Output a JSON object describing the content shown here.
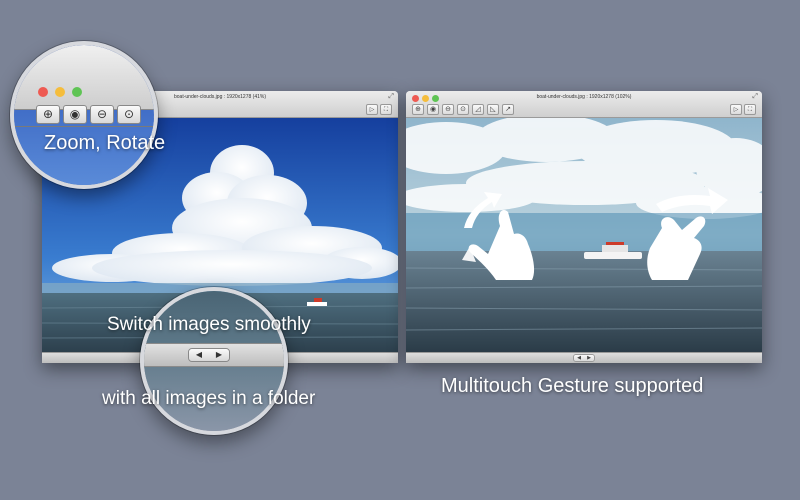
{
  "window": {
    "title": "boat-under-clouds.jpg : 1920x1278 (41%)",
    "title_right": "boat-under-clouds.jpg : 1920x1278 (102%)"
  },
  "icons": {
    "zoom_in": "zoom-in-icon",
    "zoom_actual": "zoom-actual-size-icon",
    "zoom_out": "zoom-out-icon",
    "zoom_fit": "zoom-fit-icon",
    "rotate_left": "rotate-left-icon",
    "rotate_right": "rotate-right-icon",
    "share": "share-icon",
    "slideshow": "slideshow-icon",
    "fullscreen": "fullscreen-icon",
    "prev": "prev-arrow-icon",
    "next": "next-arrow-icon",
    "pinch_gesture": "pinch-gesture-icon",
    "swipe_gesture": "swipe-gesture-icon"
  },
  "captions": {
    "zoom_rotate": "Zoom, Rotate",
    "switch_images": "Switch images smoothly",
    "folder": "with all images in a folder",
    "multitouch": "Multitouch Gesture supported"
  },
  "colors": {
    "background": "#7b8396",
    "sky_top": "#1d4db3",
    "sea": "#3b5665",
    "traffic_close": "#ee5a52",
    "traffic_min": "#f5bd3c",
    "traffic_max": "#5fc454"
  }
}
